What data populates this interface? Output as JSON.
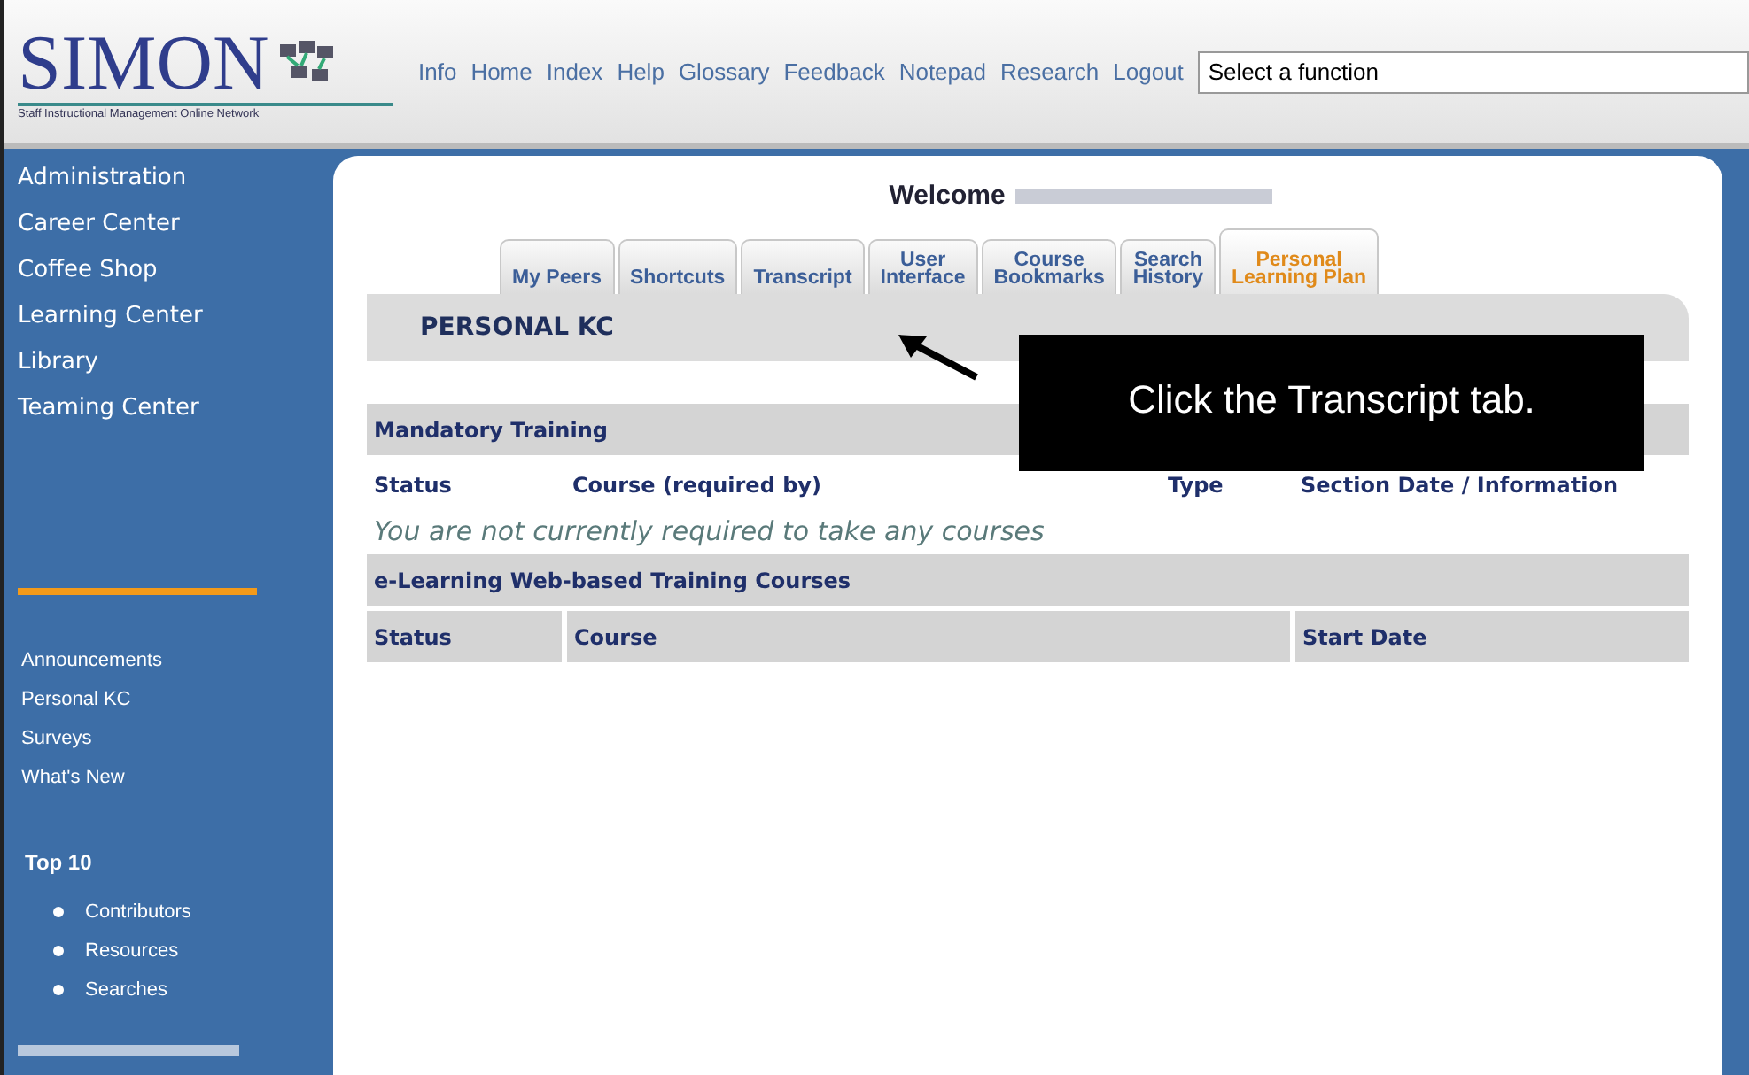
{
  "header": {
    "logo": "SIMON",
    "logo_subtitle": "Staff Instructional Management Online Network",
    "nav": [
      "Info",
      "Home",
      "Index",
      "Help",
      "Glossary",
      "Feedback",
      "Notepad",
      "Research",
      "Logout"
    ],
    "function_select": {
      "value": "Select a function"
    }
  },
  "sidebar": {
    "main_items": [
      "Administration",
      "Career Center",
      "Coffee Shop",
      "Learning Center",
      "Library",
      "Teaming Center"
    ],
    "secondary_items": [
      "Announcements",
      "Personal KC",
      "Surveys",
      "What's New"
    ],
    "top10": {
      "title": "Top 10",
      "items": [
        "Contributors",
        "Resources",
        "Searches"
      ]
    }
  },
  "welcome": "Welcome",
  "tabs": [
    {
      "label": "My Peers",
      "selected": false
    },
    {
      "label": "Shortcuts",
      "selected": false
    },
    {
      "label": "Transcript",
      "selected": false
    },
    {
      "label": "User\nInterface",
      "selected": false
    },
    {
      "label": "Course\nBookmarks",
      "selected": false
    },
    {
      "label": "Search\nHistory",
      "selected": false
    },
    {
      "label": "Personal\nLearning Plan",
      "selected": true
    }
  ],
  "section_title": "PERSONAL KC",
  "mandatory": {
    "title": "Mandatory Training",
    "columns": [
      "Status",
      "Course (required by)",
      "Type",
      "Section Date / Information"
    ],
    "empty_message": "You are not currently required to take any courses"
  },
  "elearning": {
    "title": "e-Learning Web-based Training Courses",
    "columns": [
      "Status",
      "Course",
      "Start Date"
    ]
  },
  "callout": "Click the Transcript tab."
}
